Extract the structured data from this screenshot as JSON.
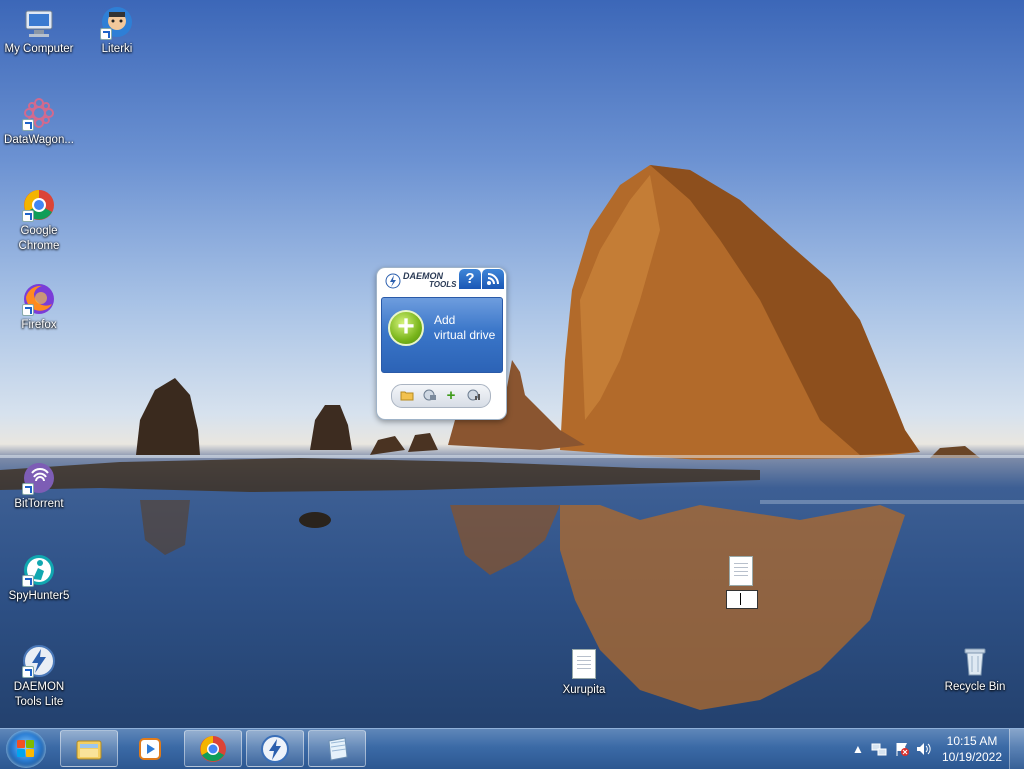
{
  "desktop": {
    "icons": [
      {
        "label": "My Computer",
        "icon": "computer-icon"
      },
      {
        "label": "Literki",
        "icon": "literki-icon"
      },
      {
        "label": "DataWagon...",
        "icon": "datawagon-icon"
      },
      {
        "label": "Google Chrome",
        "icon": "chrome-icon"
      },
      {
        "label": "Firefox",
        "icon": "firefox-icon"
      },
      {
        "label": "BitTorrent",
        "icon": "bittorrent-icon"
      },
      {
        "label": "SpyHunter5",
        "icon": "spyhunter-icon"
      },
      {
        "label": "DAEMON Tools Lite",
        "icon": "daemon-tools-icon"
      },
      {
        "label": "Xurupita",
        "icon": "text-file-icon"
      },
      {
        "label": "Recycle Bin",
        "icon": "recycle-bin-icon"
      },
      {
        "label": "",
        "icon": "text-file-icon",
        "renaming": true
      }
    ]
  },
  "gadget": {
    "logo_line1": "DAEMON",
    "logo_line2": "TOOLS",
    "help_label": "?",
    "add_line1": "Add",
    "add_line2": "virtual drive",
    "toolbar": [
      "open-image-icon",
      "mount-icon",
      "add-icon",
      "drive-settings-icon"
    ]
  },
  "taskbar": {
    "pinned": [
      "explorer-icon",
      "media-player-icon",
      "chrome-icon",
      "daemon-tools-icon",
      "notepad-icon"
    ],
    "tray": [
      "show-hidden-icons-chevron",
      "network-icon",
      "action-center-flag-icon",
      "volume-icon"
    ],
    "time": "10:15 AM",
    "date": "10/19/2022"
  },
  "colors": {
    "taskbar": "#3b6aa6",
    "gadget_accent": "#2c63b6",
    "add_green": "#79b51b"
  }
}
